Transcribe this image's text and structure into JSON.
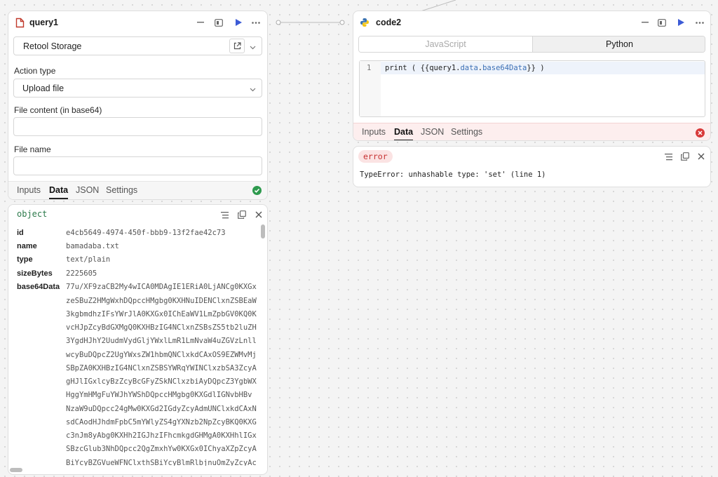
{
  "query_panel": {
    "title": "query1",
    "resource": "Retool Storage",
    "action_type_label": "Action type",
    "action_type_value": "Upload file",
    "file_content_label": "File content (in base64)",
    "file_content_value": "",
    "file_name_label": "File name",
    "file_name_value": "",
    "tabs": [
      "Inputs",
      "Data",
      "JSON",
      "Settings"
    ],
    "active_tab": "Data",
    "status": "success"
  },
  "output_panel": {
    "type_label": "object",
    "fields": [
      {
        "key": "id",
        "value": "e4cb5649-4974-450f-bbb9-13f2fae42c73"
      },
      {
        "key": "name",
        "value": "bamadaba.txt"
      },
      {
        "key": "type",
        "value": "text/plain"
      },
      {
        "key": "sizeBytes",
        "value": "2225605"
      }
    ],
    "base64_key": "base64Data",
    "base64_lines": [
      "77u/XF9zaCB2My4wICA0MDAgIE1ERiA0LjANCg0KXGx",
      "zeSBuZ2HMgWxhDQpccHMgbg0KXHNuIDENClxnZSBEaW",
      "3kgbmdhzIFsYWrJlA0KXGx0IChEaWV1LmZpbGV0KQ0K",
      "vcHJpZcyBdGXMgQ0KXHBzIG4NClxnZSBsZS5tb2luZH",
      "3YgdHJhY2UudmVydGljYWxlLmR1LmNvaW4uZGVzLnll",
      "wcyBuDQpcZ2UgYWxsZW1hbmQNClxkdCAxOS9EZWMvMj",
      "SBpZA0KXHBzIG4NClxnZSBSYWRqYWINClxzbSA3ZcyA",
      "gHJlIGxlcyBzZcyBcGFyZSkNClxzbiAyDQpcZ3YgbWX",
      "HggYmHMgFuYWJhYWShDQpccHMgbg0KXGdlIGNvbHBv",
      "NzaW9uDQpcc24gMw0KXGd2IGdyZcyAdmUNClxkdCAxN",
      "sdCAodHJhdmFpbC5mYWlyZS4gYXNzb2NpZcyBKQ0KXG",
      "c3nJm8yAbg0KXHh2IGJhzIFhcmkgdGHMgA0KXHhlIGx",
      "SBzcGlub3NhDQpcc2QgZmxhYw0KXGx0IChyaXZpZcyA",
      "BiYcyBZGVueWFNClxthSBiYcyBlmRlbjnuOmZyZcyAc"
    ]
  },
  "code_panel": {
    "title": "code2",
    "languages": [
      "JavaScript",
      "Python"
    ],
    "active_language": "Python",
    "line_number": "1",
    "code_parts": [
      "print ( {{",
      "query1",
      ".",
      "data",
      ".",
      "base64Data",
      "}}  )"
    ],
    "tabs": [
      "Inputs",
      "Data",
      "JSON",
      "Settings"
    ],
    "active_tab": "Data",
    "status": "error"
  },
  "error_panel": {
    "badge": "error",
    "message": "TypeError: unhashable type: 'set' (line 1)"
  },
  "colors": {
    "success": "#2e9a4e",
    "error": "#d83a3a",
    "run": "#3c5bd6",
    "code_keyword": "#3b6fb5"
  }
}
